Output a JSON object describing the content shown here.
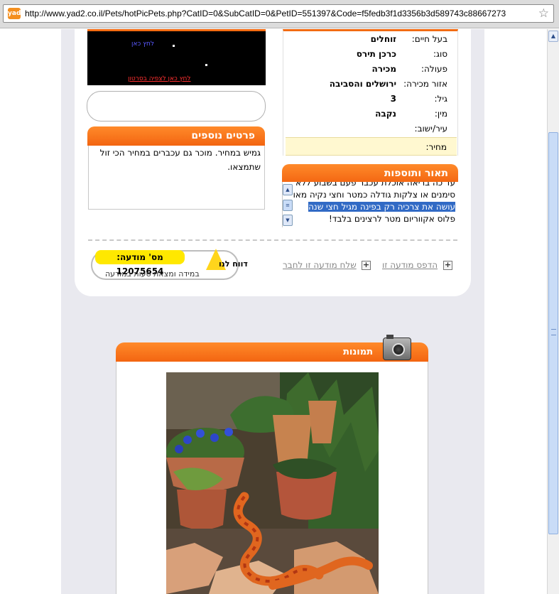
{
  "browser": {
    "url": "http://www.yad2.co.il/Pets/hotPicPets.php?CatID=0&SubCatID=0&PetID=551397&Code=f5fedb3f1d3356b3d589743c88667273",
    "site_icon": "yad2-icon",
    "star_icon": "bookmark-star-icon"
  },
  "details": {
    "rows": [
      {
        "label": "בעל חיים:",
        "value": "זוחלים"
      },
      {
        "label": "סוג:",
        "value": "כרכן תירס"
      },
      {
        "label": "פעולה:",
        "value": "מכירה"
      },
      {
        "label": "אזור מכירה:",
        "value": "ירושלים והסביבה"
      },
      {
        "label": "גיל:",
        "value": "3"
      },
      {
        "label": "מין:",
        "value": "נקבה"
      },
      {
        "label": "עיר/ישוב:",
        "value": ""
      }
    ],
    "price_label": "מחיר:"
  },
  "extra": {
    "title": "פרטים נוספים",
    "text": "גמיש במחיר. מוכר גם עכברים במחיר הכי זול שתמצאו."
  },
  "description": {
    "title": "תאור ותוספות",
    "lines": [
      "עד כה בריאה אוכלת עכבר פעם בשבוע ללא",
      "סימנים או צלקות גודלה כמטר וחצי נקיה מאוד",
      "עושה את צרכיה רק בפינה מגיל חצי שנה",
      "פלוס אקווריום מטר לרצינים בלבד!"
    ]
  },
  "video": {
    "line1": "לחץ כאן",
    "line2": "לחץ כאן לצפיה בסרטון"
  },
  "actions": {
    "print": "הדפס מודעה זו",
    "send": "שלח מודעה זו לחבר"
  },
  "report": {
    "ad_number": "מס' מודעה: 12075654",
    "label": "דווח לנו",
    "sub": "במידה ומצאת טעות במודעה"
  },
  "pictures": {
    "title": "תמונות"
  }
}
